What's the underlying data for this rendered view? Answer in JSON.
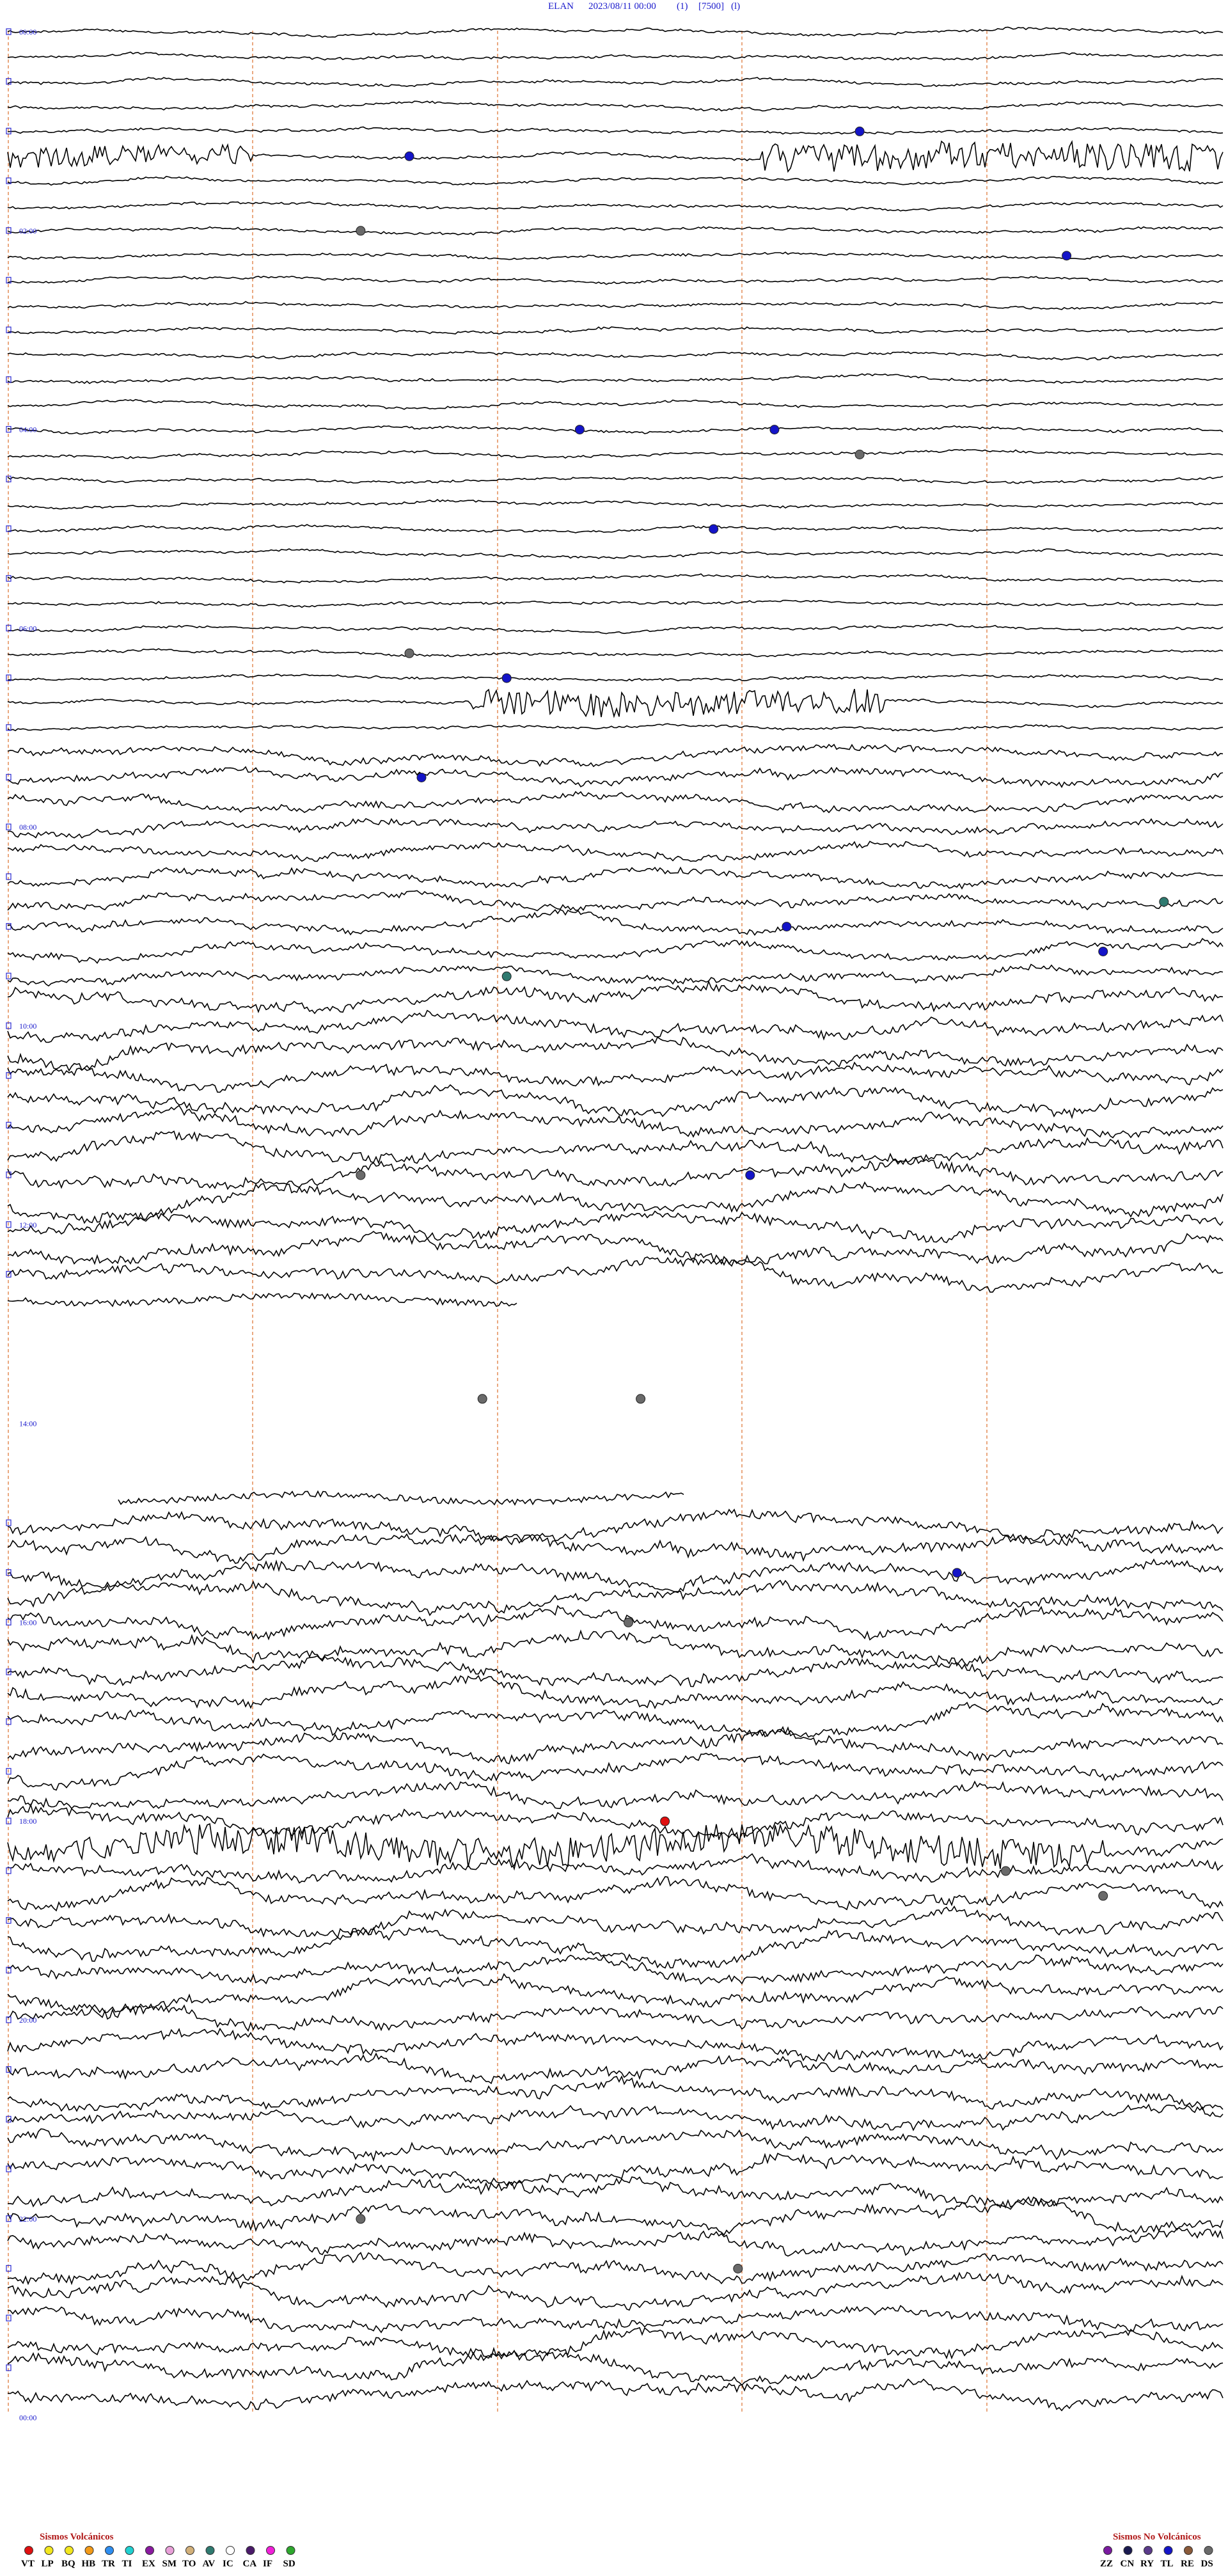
{
  "header": {
    "station": "ELAN",
    "datetime": "2023/08/11 00:00",
    "field1": "(1)",
    "field2": "[7500]",
    "field3": "(l)"
  },
  "chart_data": {
    "type": "helicorder",
    "hour_labels": [
      "00:00",
      "02:00",
      "04:00",
      "06:00",
      "08:00",
      "10:00",
      "12:00",
      "14:00",
      "16:00",
      "18:00",
      "20:00",
      "22:00",
      "00:00"
    ],
    "trace_count": 96,
    "minutes_per_line": 15,
    "gap_hours": [
      12.75,
      15.0
    ],
    "bursts": [
      {
        "from_hour": 1.25,
        "start": 0.62,
        "end": 1.0,
        "amp": 22
      },
      {
        "from_hour": 1.25,
        "start": 0.0,
        "end": 0.2,
        "amp": 16
      },
      {
        "from_hour": 6.75,
        "start": 0.38,
        "end": 0.72,
        "amp": 20
      },
      {
        "from_hour": 18.25,
        "start": 0.14,
        "end": 0.9,
        "amp": 24
      },
      {
        "from_hour": 18.25,
        "start": 0.0,
        "end": 0.14,
        "amp": 18
      }
    ],
    "events": [
      {
        "hour": 1.0,
        "frac": 0.7,
        "type": "TL"
      },
      {
        "hour": 1.25,
        "frac": 0.33,
        "type": "TL"
      },
      {
        "hour": 2.0,
        "frac": 0.29,
        "type": "DS"
      },
      {
        "hour": 2.25,
        "frac": 0.87,
        "type": "TL"
      },
      {
        "hour": 4.0,
        "frac": 0.47,
        "type": "TL"
      },
      {
        "hour": 4.0,
        "frac": 0.63,
        "type": "TL"
      },
      {
        "hour": 4.25,
        "frac": 0.7,
        "type": "DS"
      },
      {
        "hour": 5.0,
        "frac": 0.58,
        "type": "TL"
      },
      {
        "hour": 6.25,
        "frac": 0.33,
        "type": "DS"
      },
      {
        "hour": 6.5,
        "frac": 0.41,
        "type": "TL"
      },
      {
        "hour": 7.5,
        "frac": 0.34,
        "type": "TL"
      },
      {
        "hour": 9.0,
        "frac": 0.64,
        "type": "TL"
      },
      {
        "hour": 9.25,
        "frac": 0.9,
        "type": "TL"
      },
      {
        "hour": 9.5,
        "frac": 0.41,
        "type": "AV"
      },
      {
        "hour": 8.75,
        "frac": 0.95,
        "type": "AV"
      },
      {
        "hour": 11.5,
        "frac": 0.61,
        "type": "TL"
      },
      {
        "hour": 11.5,
        "frac": 0.29,
        "type": "DS"
      },
      {
        "hour": 13.75,
        "frac": 0.39,
        "type": "DS"
      },
      {
        "hour": 13.75,
        "frac": 0.52,
        "type": "DS"
      },
      {
        "hour": 15.5,
        "frac": 0.78,
        "type": "TL"
      },
      {
        "hour": 16.0,
        "frac": 0.51,
        "type": "DS"
      },
      {
        "hour": 18.0,
        "frac": 0.54,
        "type": "VT"
      },
      {
        "hour": 18.5,
        "frac": 0.82,
        "type": "DS"
      },
      {
        "hour": 18.75,
        "frac": 0.9,
        "type": "DS"
      },
      {
        "hour": 22.0,
        "frac": 0.29,
        "type": "DS"
      },
      {
        "hour": 22.5,
        "frac": 0.6,
        "type": "DS"
      }
    ]
  },
  "legend": {
    "volcanic": {
      "title": "Sismos Volcánicos",
      "items": [
        {
          "code": "VT",
          "color": "#e01010"
        },
        {
          "code": "LP",
          "color": "#f2e61e"
        },
        {
          "code": "BQ",
          "color": "#f2e61e"
        },
        {
          "code": "HB",
          "color": "#f29a18"
        },
        {
          "code": "TR",
          "color": "#2e8ef0"
        },
        {
          "code": "TI",
          "color": "#20d0d0"
        },
        {
          "code": "EX",
          "color": "#8a1aa0"
        },
        {
          "code": "SM",
          "color": "#e8a0d8"
        },
        {
          "code": "TO",
          "color": "#d2b07a"
        },
        {
          "code": "AV",
          "color": "#2f7a70"
        },
        {
          "code": "IC",
          "color": "#ffffff"
        },
        {
          "code": "CA",
          "color": "#4a1a6a"
        },
        {
          "code": "IF",
          "color": "#f020d8"
        },
        {
          "code": "SD",
          "color": "#2ea82e"
        }
      ]
    },
    "non_volcanic": {
      "title": "Sismos No Volcánicos",
      "items": [
        {
          "code": "ZZ",
          "color": "#7a1aa0"
        },
        {
          "code": "CN",
          "color": "#1a1a50"
        },
        {
          "code": "RY",
          "color": "#5a3a8a"
        },
        {
          "code": "TL",
          "color": "#1414c8"
        },
        {
          "code": "RE",
          "color": "#8a5a3a"
        },
        {
          "code": "DS",
          "color": "#6a6a6a"
        }
      ]
    }
  }
}
